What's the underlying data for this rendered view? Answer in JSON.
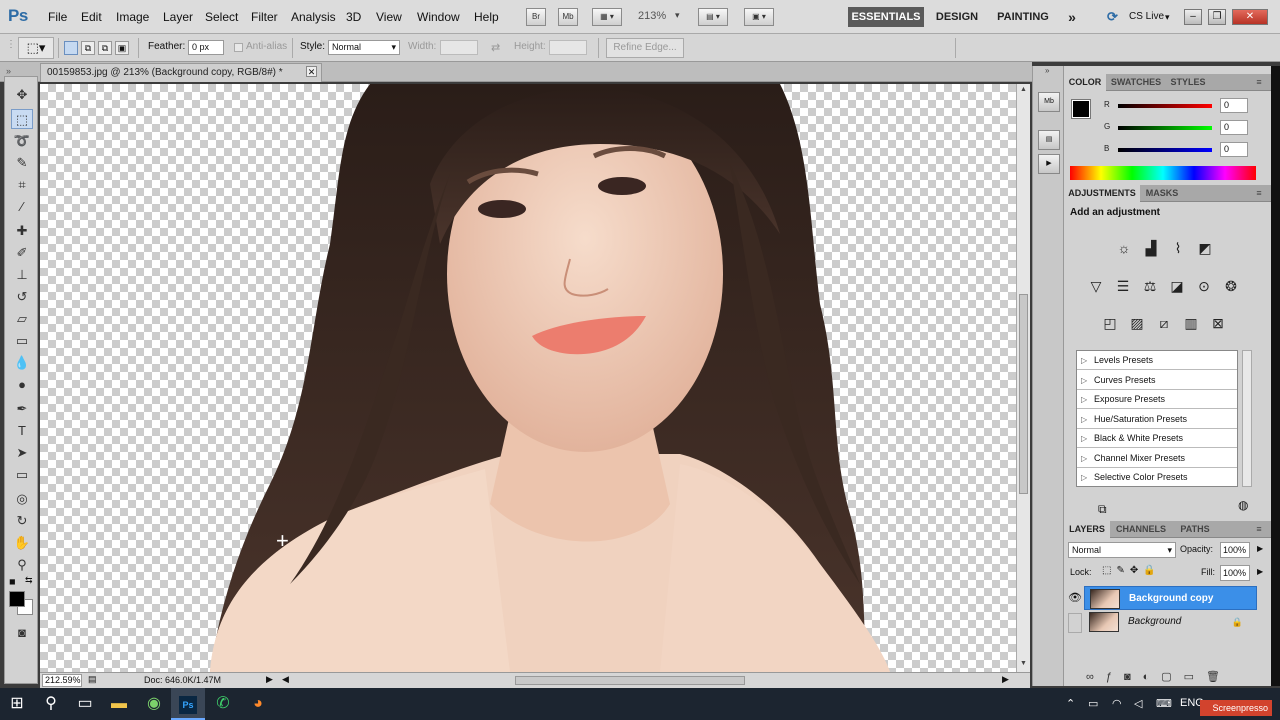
{
  "app": {
    "logo": "Ps"
  },
  "menu": [
    "File",
    "Edit",
    "Image",
    "Layer",
    "Select",
    "Filter",
    "Analysis",
    "3D",
    "View",
    "Window",
    "Help"
  ],
  "appbar": {
    "bridge": "Br",
    "minibridge": "Mb",
    "zoom": "213%"
  },
  "workspaces": {
    "essentials": "ESSENTIALS",
    "design": "DESIGN",
    "painting": "PAINTING",
    "more": "»",
    "cslive": "CS Live"
  },
  "options": {
    "feather_label": "Feather:",
    "feather_value": "0 px",
    "antialias_label": "Anti-alias",
    "style_label": "Style:",
    "style_value": "Normal",
    "width_label": "Width:",
    "height_label": "Height:",
    "refine_label": "Refine Edge..."
  },
  "document": {
    "tab_title": "00159853.jpg @ 213% (Background copy, RGB/8#) *"
  },
  "status": {
    "zoom": "212.59%",
    "doc_info": "Doc: 646.0K/1.47M"
  },
  "color_panel": {
    "tabs": [
      "COLOR",
      "SWATCHES",
      "STYLES"
    ],
    "r_label": "R",
    "g_label": "G",
    "b_label": "B",
    "r": "0",
    "g": "0",
    "b": "0"
  },
  "adjustments_panel": {
    "tabs": [
      "ADJUSTMENTS",
      "MASKS"
    ],
    "heading": "Add an adjustment",
    "presets": [
      "Levels Presets",
      "Curves Presets",
      "Exposure Presets",
      "Hue/Saturation Presets",
      "Black & White Presets",
      "Channel Mixer Presets",
      "Selective Color Presets"
    ]
  },
  "layers_panel": {
    "tabs": [
      "LAYERS",
      "CHANNELS",
      "PATHS"
    ],
    "blend_mode": "Normal",
    "opacity_label": "Opacity:",
    "opacity": "100%",
    "lock_label": "Lock:",
    "fill_label": "Fill:",
    "fill": "100%",
    "layers": [
      {
        "name": "Background copy",
        "selected": true
      },
      {
        "name": "Background",
        "selected": false
      }
    ]
  },
  "taskbar": {
    "language": "ENG",
    "watermark": "Screenpresso"
  },
  "colors": {
    "selection": "#3b8fe8",
    "accent_ps": "#2e6ca6",
    "taskbar": "#1c2530"
  }
}
